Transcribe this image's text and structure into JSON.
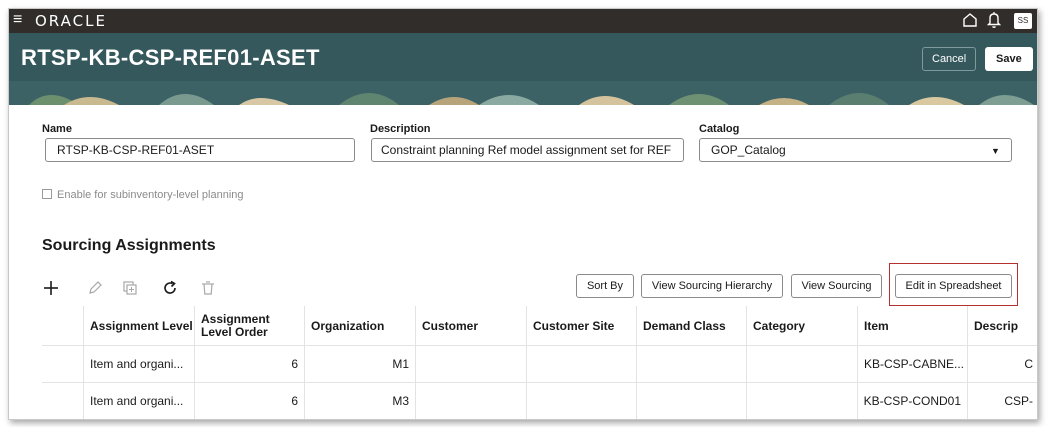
{
  "topbar": {
    "brand": "ORACLE",
    "user_initials": "SS"
  },
  "header": {
    "title": "RTSP-KB-CSP-REF01-ASET",
    "cancel_label": "Cancel",
    "save_label": "Save"
  },
  "form": {
    "name_label": "Name",
    "name_value": "RTSP-KB-CSP-REF01-ASET",
    "description_label": "Description",
    "description_value": "Constraint planning Ref model assignment set for REF",
    "catalog_label": "Catalog",
    "catalog_value": "GOP_Catalog",
    "subinventory_label": "Enable for subinventory-level planning",
    "subinventory_checked": false
  },
  "sourcing": {
    "title": "Sourcing Assignments",
    "sort_by_label": "Sort By",
    "view_hierarchy_label": "View Sourcing Hierarchy",
    "view_sourcing_label": "View Sourcing",
    "edit_spreadsheet_label": "Edit in Spreadsheet",
    "columns": [
      "Assignment Level",
      "Assignment Level Order",
      "Organization",
      "Customer",
      "Customer Site",
      "Demand Class",
      "Category",
      "Item",
      "Descrip"
    ],
    "rows": [
      [
        "Item and organi...",
        "6",
        "M1",
        "",
        "",
        "",
        "",
        "KB-CSP-CABNE...",
        "C"
      ],
      [
        "Item and organi...",
        "6",
        "M3",
        "",
        "",
        "",
        "",
        "KB-CSP-COND01",
        "CSP-"
      ]
    ]
  },
  "icons": {
    "menu": "hamburger-icon",
    "home": "home-icon",
    "notifications": "bell-icon",
    "add": "plus-icon",
    "edit": "pencil-icon",
    "duplicate": "duplicate-icon",
    "refresh": "refresh-icon",
    "delete": "trash-icon"
  },
  "colors": {
    "topbar": "#312d2a",
    "header": "#35585c",
    "highlight": "#b5312d"
  }
}
